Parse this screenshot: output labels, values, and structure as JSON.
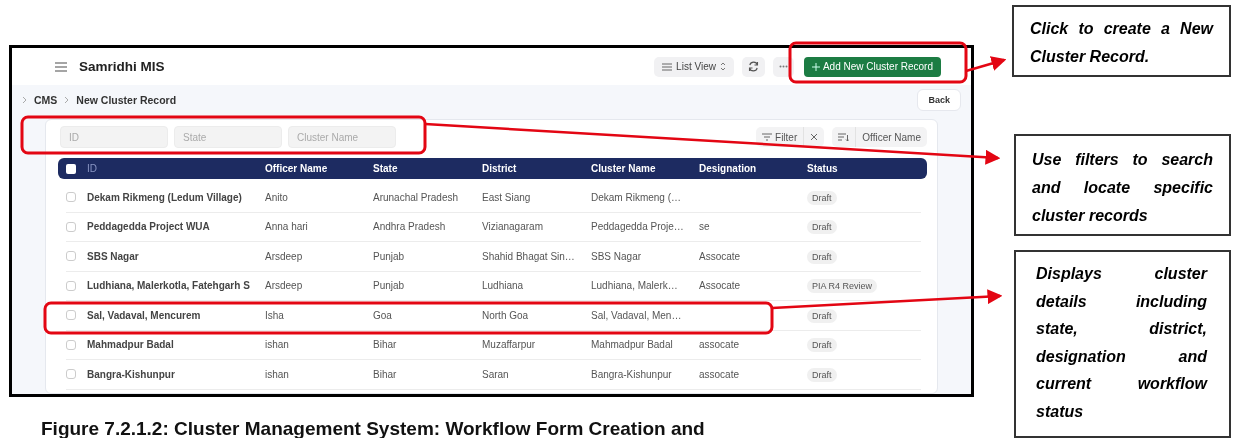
{
  "app": {
    "title": "Samridhi MIS",
    "view_menu": "List View",
    "add_button": "Add New Cluster Record"
  },
  "breadcrumb": [
    "CMS",
    "New Cluster Record"
  ],
  "back_button": "Back",
  "filters": [
    {
      "placeholder": "ID"
    },
    {
      "placeholder": "State"
    },
    {
      "placeholder": "Cluster Name"
    }
  ],
  "filter_button": "Filter",
  "sort_button": "Officer Name",
  "table": {
    "select_all_checked": false,
    "columns": [
      "ID",
      "Officer Name",
      "State",
      "District",
      "Cluster Name",
      "Designation",
      "Status"
    ],
    "rows": [
      {
        "checked": false,
        "cells": [
          "Dekam Rikmeng (Ledum Village)",
          "Anito",
          "Arunachal Pradesh",
          "East Siang",
          "Dekam Rikmeng (…",
          "",
          "Draft"
        ]
      },
      {
        "checked": false,
        "cells": [
          "Peddagedda Project WUA",
          "Anna hari",
          "Andhra Pradesh",
          "Vizianagaram",
          "Peddagedda Proje…",
          "se",
          "Draft"
        ]
      },
      {
        "checked": false,
        "cells": [
          "SBS Nagar",
          "Arsdeep",
          "Punjab",
          "Shahid Bhagat Sin…",
          "SBS Nagar",
          "Assocate",
          "Draft"
        ]
      },
      {
        "checked": false,
        "cells": [
          "Ludhiana, Malerkotla, Fatehgarh S",
          "Arsdeep",
          "Punjab",
          "Ludhiana",
          "Ludhiana, Malerk…",
          "Assocate",
          "PIA R4 Review"
        ]
      },
      {
        "checked": false,
        "cells": [
          "Sal, Vadaval, Mencurem",
          "Isha",
          "Goa",
          "North Goa",
          "Sal, Vadaval, Men…",
          "",
          "Draft"
        ]
      },
      {
        "checked": false,
        "cells": [
          "Mahmadpur Badal",
          "ishan",
          "Bihar",
          "Muzaffarpur",
          "Mahmadpur Badal",
          "assocate",
          "Draft"
        ]
      },
      {
        "checked": false,
        "cells": [
          "Bangra-Kishunpur",
          "ishan",
          "Bihar",
          "Saran",
          "Bangra-Kishunpur",
          "assocate",
          "Draft"
        ]
      }
    ]
  },
  "notes": [
    {
      "text": "Click to create a New Cluster Record."
    },
    {
      "text": "Use filters to search and locate specific cluster records"
    },
    {
      "text": "Displays cluster details including state, district, designation and current workflow status"
    }
  ],
  "caption": "Figure 7.2.1.2: Cluster Management System: Workflow Form Creation and"
}
